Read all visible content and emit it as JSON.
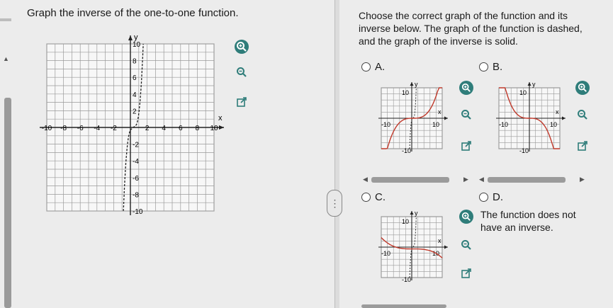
{
  "question": {
    "text": "Graph the inverse of the one-to-one function."
  },
  "instructions": {
    "text": "Choose the correct graph of the function and its inverse below. The graph of the function is dashed, and the graph of the inverse is solid."
  },
  "main_graph": {
    "y_axis_label": "y",
    "x_axis_label": "x",
    "x_ticks": [
      "-10",
      "-8",
      "-6",
      "-4",
      "-2",
      "2",
      "4",
      "6",
      "8",
      "10"
    ],
    "y_ticks": [
      "10",
      "8",
      "6",
      "4",
      "2",
      "-2",
      "-4",
      "-6",
      "-8",
      "-10"
    ],
    "xlim": [
      -10,
      10
    ],
    "ylim": [
      -10,
      10
    ]
  },
  "options": [
    {
      "letter": "A.",
      "top_label": "10",
      "right_label": "10",
      "left_label": "-10",
      "bottom_label": "-10",
      "y_label": "y",
      "x_label": "x"
    },
    {
      "letter": "B.",
      "top_label": "10",
      "right_label": "10",
      "left_label": "-10",
      "bottom_label": "-10",
      "y_label": "y",
      "x_label": "x"
    },
    {
      "letter": "C.",
      "top_label": "10",
      "right_label": "10",
      "left_label": "-10",
      "bottom_label": "-10",
      "y_label": "y",
      "x_label": "x"
    },
    {
      "letter": "D.",
      "text": "The function does not have an inverse."
    }
  ],
  "colors": {
    "zoom_active": "#2f7d7a",
    "curve": "#c0392b",
    "grid": "#8a8a8a"
  },
  "icons": {
    "zoom_in": "zoom-in-icon",
    "zoom_out": "zoom-out-icon",
    "external": "external-link-icon"
  }
}
